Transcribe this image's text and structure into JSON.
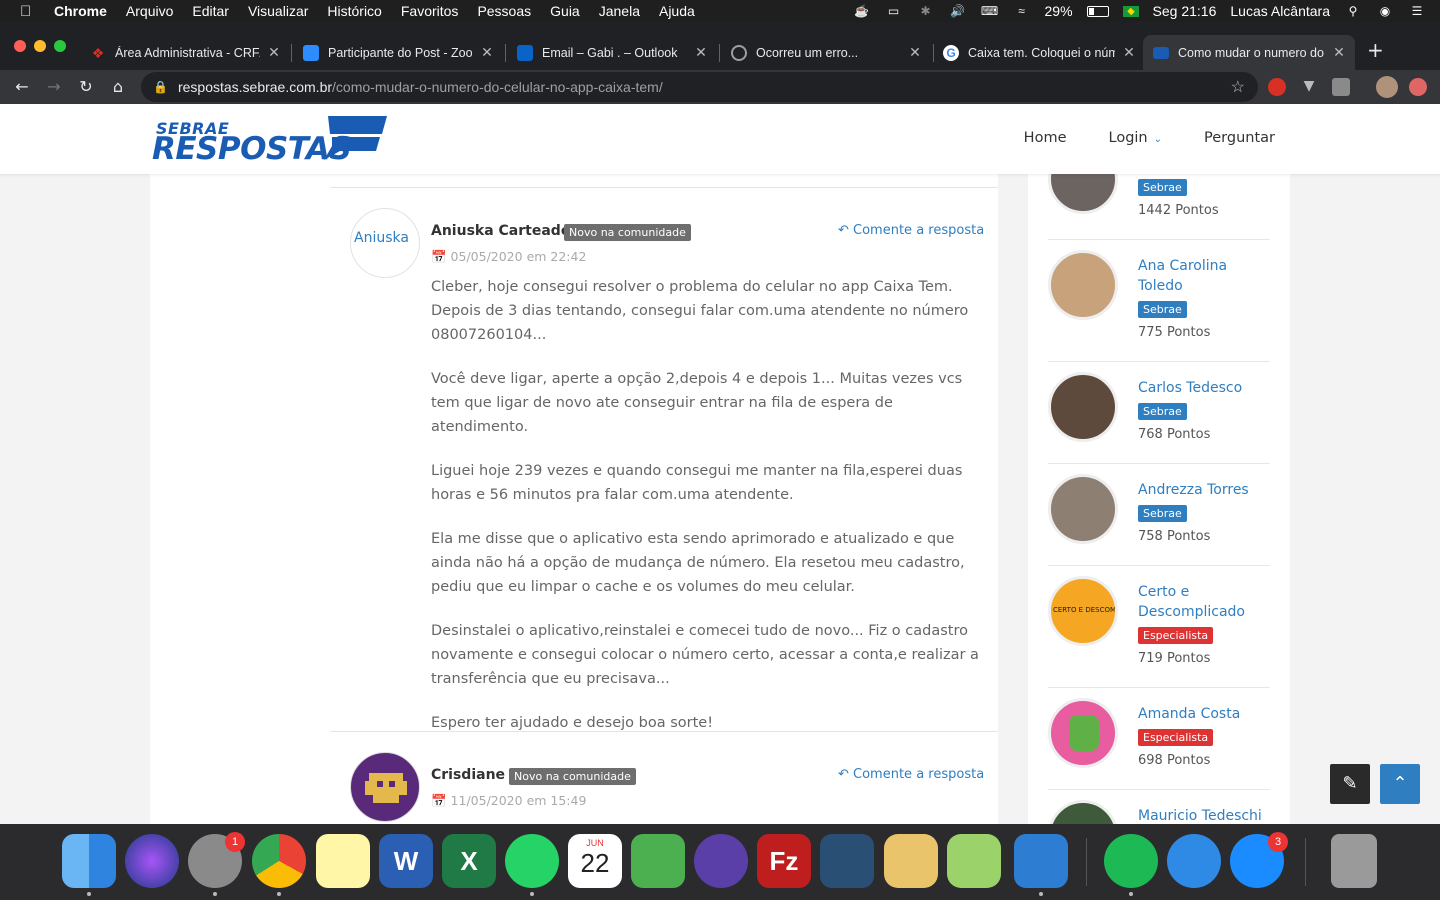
{
  "menubar": {
    "app": "Chrome",
    "items": [
      "Arquivo",
      "Editar",
      "Visualizar",
      "Histórico",
      "Favoritos",
      "Pessoas",
      "Guia",
      "Janela",
      "Ajuda"
    ],
    "battery": "29%",
    "clock": "Seg 21:16",
    "user": "Lucas Alcântara"
  },
  "tabs": [
    {
      "title": "Área Administrativa - CRF/",
      "icon": "crf-icon",
      "color": "#d93025"
    },
    {
      "title": "Participante do Post - Zoo",
      "icon": "zoom-icon",
      "color": "#2d8cff"
    },
    {
      "title": "Email – Gabi . – Outlook",
      "icon": "outlook-icon",
      "color": "#0a64c8"
    },
    {
      "title": "Ocorreu um erro...",
      "icon": "error-globe-icon",
      "color": "#5f6368"
    },
    {
      "title": "Caixa tem. Coloquei o núm",
      "icon": "google-icon",
      "color": "#fff"
    },
    {
      "title": "Como mudar o numero do",
      "icon": "sebrae-icon",
      "color": "#1a5cb3"
    }
  ],
  "url": {
    "host": "respostas.sebrae.com.br",
    "path": "/como-mudar-o-numero-do-celular-no-app-caixa-tem/"
  },
  "site": {
    "logo_top": "SEBRAE",
    "logo_bottom": "RESPOSTAS",
    "nav": {
      "home": "Home",
      "login": "Login",
      "ask": "Perguntar"
    }
  },
  "answers": [
    {
      "author": "Aniuska Carteado",
      "avatar_alt": "Aniuska",
      "badge": "Novo na comunidade",
      "date": "05/05/2020 em 22:42",
      "comment": "Comente a resposta",
      "paragraphs": [
        "Cleber, hoje consegui resolver o problema do celular no app Caixa Tem. Depois de 3 dias tentando, consegui falar com.uma atendente no número 08007260104...",
        "Você deve ligar, aperte a opção 2,depois 4 e depois 1... Muitas vezes vcs tem que ligar de novo ate conseguir entrar na fila de espera de atendimento.",
        "Liguei hoje 239 vezes e quando consegui me manter na fila,esperei duas horas e 56 minutos pra falar com.uma atendente.",
        "Ela me disse que o aplicativo esta sendo aprimorado e atualizado e que ainda não há a opção de mudança de número. Ela resetou meu cadastro, pediu que eu limpar o cache e os volumes do meu celular.",
        "Desinstalei o aplicativo,reinstalei e comecei tudo de novo... Fiz o cadastro novamente e consegui colocar o número certo, acessar a conta,e realizar a transferência que eu precisava...",
        "Espero ter ajudado e desejo boa sorte!"
      ]
    },
    {
      "author": "Crisdiane",
      "badge": "Novo na comunidade",
      "date": "11/05/2020 em 15:49",
      "comment": "Comente a resposta"
    }
  ],
  "ranking": [
    {
      "name": "",
      "tag": "Sebrae",
      "tag_color": "#2f7ec0",
      "points": "1442 Pontos"
    },
    {
      "name": "Ana Carolina Toledo",
      "tag": "Sebrae",
      "tag_color": "#2f7ec0",
      "points": "775 Pontos"
    },
    {
      "name": "Carlos Tedesco",
      "tag": "Sebrae",
      "tag_color": "#2f7ec0",
      "points": "768 Pontos"
    },
    {
      "name": "Andrezza Torres",
      "tag": "Sebrae",
      "tag_color": "#2f7ec0",
      "points": "758 Pontos"
    },
    {
      "name": "Certo e Descomplicado",
      "tag": "Especialista",
      "tag_color": "#dd3333",
      "points": "719 Pontos",
      "avatar_text": "CERTO E DESCOM"
    },
    {
      "name": "Amanda Costa",
      "tag": "Especialista",
      "tag_color": "#dd3333",
      "points": "698 Pontos"
    },
    {
      "name": "Mauricio Tedeschi"
    }
  ],
  "dock": {
    "apps": [
      "finder-icon",
      "siri-icon",
      "system-preferences-icon",
      "chrome-icon",
      "notes-icon",
      "word-icon",
      "excel-icon",
      "whatsapp-icon",
      "calendar-icon",
      "network-app-icon",
      "lunar-icon",
      "filezilla-icon",
      "mysql-workbench-icon",
      "sequel-icon",
      "db-search-icon",
      "vscode-icon",
      "spotify-icon",
      "safari-icon",
      "app-store-icon",
      "trash-icon"
    ],
    "calendar_month": "JUN",
    "calendar_day": "22",
    "badge_prefs": "1",
    "badge_appstore": "3"
  }
}
